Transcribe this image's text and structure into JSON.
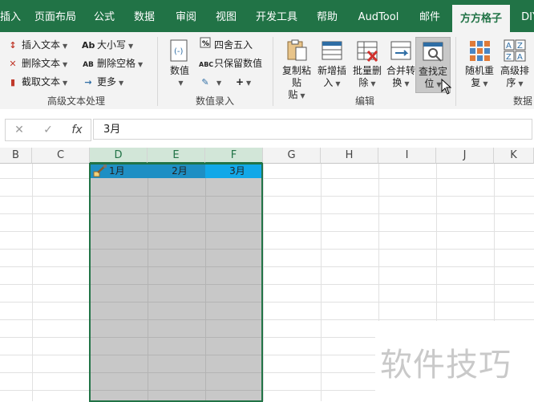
{
  "ribbon_tabs": [
    {
      "label": "插入",
      "active": false
    },
    {
      "label": "页面布局",
      "active": false
    },
    {
      "label": "公式",
      "active": false
    },
    {
      "label": "数据",
      "active": false
    },
    {
      "label": "审阅",
      "active": false
    },
    {
      "label": "视图",
      "active": false
    },
    {
      "label": "开发工具",
      "active": false
    },
    {
      "label": "帮助",
      "active": false
    },
    {
      "label": "AudTool",
      "active": false
    },
    {
      "label": "邮件",
      "active": false
    },
    {
      "label": "方方格子",
      "active": true
    },
    {
      "label": "DIY",
      "active": false
    }
  ],
  "groups": {
    "text": {
      "label": "高级文本处理",
      "insert_text": "插入文本",
      "delete_text": "删除文本",
      "extract_text": "截取文本",
      "case": "大小写",
      "delete_space": "删除空格",
      "more": "更多"
    },
    "number": {
      "label": "数值录入",
      "numeric": "数值",
      "round": "四舍五入",
      "keep_value": "只保留数值"
    },
    "edit": {
      "label": "编辑",
      "copy_paste": "复制粘贴",
      "copy_paste_l2": "贴",
      "insert_new": "新增插",
      "insert_new_l2": "入",
      "batch_delete": "批量删",
      "batch_delete_l2": "除",
      "merge_convert": "合并转",
      "merge_convert_l2": "换",
      "find_locate": "查找定",
      "find_locate_l2": "位"
    },
    "data": {
      "label": "数据",
      "random_repeat": "随机重",
      "random_repeat_l2": "复",
      "advanced_sort": "高级排",
      "advanced_sort_l2": "序"
    }
  },
  "formula_bar": {
    "cancel": "✕",
    "confirm": "✓",
    "fx": "fx",
    "value": "3月"
  },
  "columns": [
    {
      "label": "B",
      "selected": false
    },
    {
      "label": "C",
      "selected": false
    },
    {
      "label": "D",
      "selected": true
    },
    {
      "label": "E",
      "selected": true
    },
    {
      "label": "F",
      "selected": true
    },
    {
      "label": "G",
      "selected": false
    },
    {
      "label": "H",
      "selected": false
    },
    {
      "label": "I",
      "selected": false
    },
    {
      "label": "J",
      "selected": false
    },
    {
      "label": "K",
      "selected": false
    }
  ],
  "header_row": [
    "1月",
    "2月",
    "3月"
  ],
  "watermark": "软件技巧",
  "colors": {
    "accent": "#217346",
    "header_band": "#1e8fc4",
    "header_band_active": "#12a8e8",
    "selection": "#c8c8c8"
  }
}
